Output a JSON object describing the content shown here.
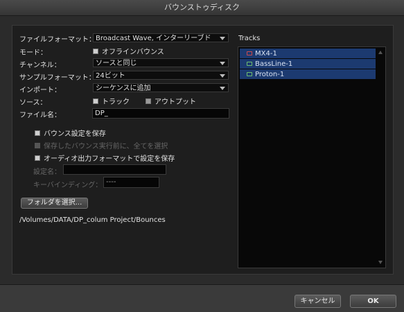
{
  "window": {
    "title": "バウンストゥディスク"
  },
  "form": {
    "file_format_label": "ファイルフォーマット：",
    "file_format_value": "Broadcast Wave, インターリーブド",
    "mode_label": "モード：",
    "offline_bounce_label": "オフラインバウンス",
    "channel_label": "チャンネル：",
    "channel_value": "ソースと同じ",
    "sample_format_label": "サンプルフォーマット：",
    "sample_format_value": "24ビット",
    "import_label": "インポート：",
    "import_value": "シーケンスに追加",
    "source_label": "ソース：",
    "source_track_label": "トラック",
    "source_output_label": "アウトプット",
    "filename_label": "ファイル名：",
    "filename_value": "DP_",
    "save_bounce_settings_label": "バウンス設定を保存",
    "select_all_before_label": "保存したバウンス実行前に、全てを選択",
    "save_audio_output_label": "オーディオ出力フォーマットで設定を保存",
    "setting_name_label": "設定名：",
    "keybinding_label": "キーバインディング：",
    "keybinding_value": "----",
    "select_folder_button": "フォルダを選択...",
    "folder_path": "/Volumes/DATA/DP_colum Project/Bounces"
  },
  "tracks": {
    "header": "Tracks",
    "items": [
      {
        "name": "MX4-1",
        "icon": "instrument-track-icon",
        "color": "#d24a4a"
      },
      {
        "name": "BassLine-1",
        "icon": "instrument-track-icon",
        "color": "#6ec070"
      },
      {
        "name": "Proton-1",
        "icon": "instrument-track-icon",
        "color": "#6ec070"
      }
    ]
  },
  "buttons": {
    "cancel": "キャンセル",
    "ok": "OK"
  }
}
